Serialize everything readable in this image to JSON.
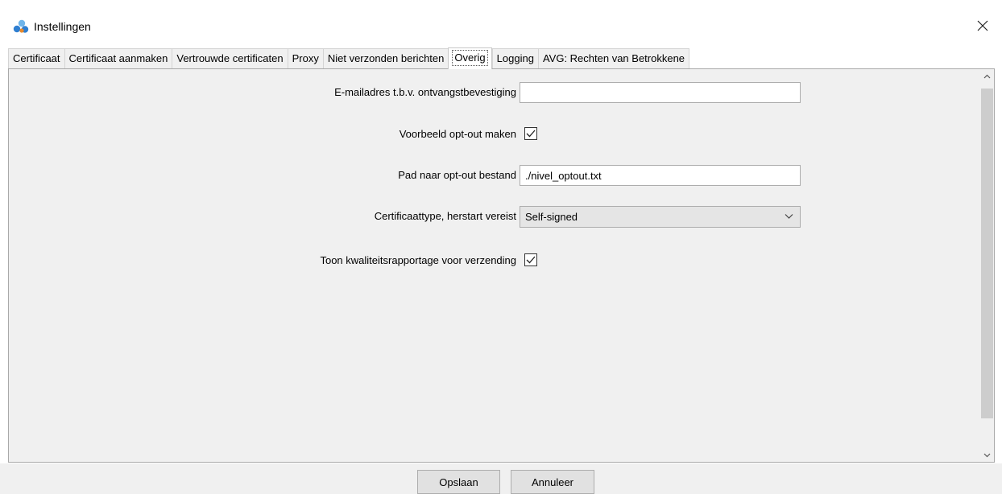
{
  "window": {
    "title": "Instellingen",
    "close_icon": "close-icon",
    "app_icon": "app-logo-icon"
  },
  "tabs": [
    {
      "label": "Certificaat",
      "active": false
    },
    {
      "label": "Certificaat aanmaken",
      "active": false
    },
    {
      "label": "Vertrouwde certificaten",
      "active": false
    },
    {
      "label": "Proxy",
      "active": false
    },
    {
      "label": "Niet verzonden berichten",
      "active": false
    },
    {
      "label": "Overig",
      "active": true
    },
    {
      "label": "Logging",
      "active": false
    },
    {
      "label": "AVG: Rechten van Betrokkene",
      "active": false
    }
  ],
  "form": {
    "email_label": "E-mailadres t.b.v. ontvangstbevestiging",
    "email_value": "",
    "optout_example_label": "Voorbeeld opt-out maken",
    "optout_example_checked": true,
    "optout_path_label": "Pad naar opt-out bestand",
    "optout_path_value": "./nivel_optout.txt",
    "cert_type_label": "Certificaattype, herstart vereist",
    "cert_type_value": "Self-signed",
    "quality_report_label": "Toon kwaliteitsrapportage voor verzending",
    "quality_report_checked": true
  },
  "buttons": {
    "save": "Opslaan",
    "cancel": "Annuleer"
  },
  "colors": {
    "app_icon_blue": "#2f7fd1",
    "app_icon_light": "#6fb5ea",
    "app_icon_orange": "#e8892b",
    "panel_bg": "#f0f0f0"
  }
}
